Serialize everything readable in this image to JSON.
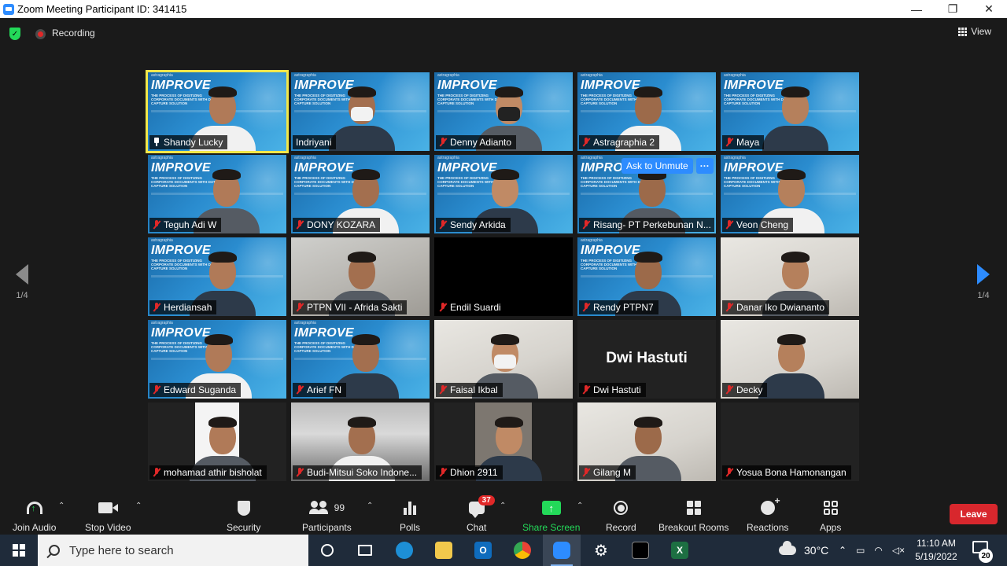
{
  "window": {
    "title": "Zoom Meeting Participant ID: 341415",
    "minimize": "—",
    "restore": "❐",
    "close": "✕"
  },
  "topbar": {
    "recording_label": "Recording",
    "view_label": "View"
  },
  "pager": {
    "left_text": "1/4",
    "right_text": "1/4"
  },
  "ask_to_unmute": {
    "label": "Ask to Unmute",
    "more": "···"
  },
  "tiles": [
    {
      "name": "Shandy Lucky",
      "bg": "improve",
      "state": "pinned",
      "active": true
    },
    {
      "name": "Indriyani",
      "bg": "improve",
      "state": "none"
    },
    {
      "name": "Denny Adianto",
      "bg": "improve",
      "state": "muted"
    },
    {
      "name": "Astragraphia 2",
      "bg": "improve",
      "state": "muted"
    },
    {
      "name": "Maya",
      "bg": "improve",
      "state": "muted"
    },
    {
      "name": "Teguh Adi W",
      "bg": "improve",
      "state": "muted"
    },
    {
      "name": "DONY KOZARA",
      "bg": "improve",
      "state": "muted"
    },
    {
      "name": "Sendy Arkida",
      "bg": "improve",
      "state": "muted"
    },
    {
      "name": "Risang- PT Perkebunan N...",
      "bg": "improve",
      "state": "muted"
    },
    {
      "name": "Veon Cheng",
      "bg": "improve",
      "state": "muted"
    },
    {
      "name": "Herdiansah",
      "bg": "improve",
      "state": "muted"
    },
    {
      "name": "PTPN VII - Afrida Sakti",
      "bg": "room",
      "state": "muted"
    },
    {
      "name": "Endil Suardi",
      "bg": "black",
      "state": "muted"
    },
    {
      "name": "Rendy PTPN7",
      "bg": "improve",
      "state": "muted"
    },
    {
      "name": "Danar Iko Dwiananto",
      "bg": "white-room",
      "state": "muted"
    },
    {
      "name": "Edward Suganda",
      "bg": "improve",
      "state": "muted"
    },
    {
      "name": "Arief FN",
      "bg": "improve",
      "state": "muted"
    },
    {
      "name": "Faisal Ikbal",
      "bg": "white-room",
      "state": "muted"
    },
    {
      "name": "Dwi Hastuti",
      "bg": "dark",
      "state": "muted",
      "card": "Dwi Hastuti"
    },
    {
      "name": "Decky",
      "bg": "white-room",
      "state": "muted"
    },
    {
      "name": "mohamad athir bisholat",
      "bg": "dark",
      "state": "muted",
      "portrait": true
    },
    {
      "name": "Budi-Mitsui Soko Indone...",
      "bg": "ceiling",
      "state": "muted"
    },
    {
      "name": "Dhion 2911",
      "bg": "dark",
      "state": "muted",
      "portrait": true
    },
    {
      "name": "Gilang M",
      "bg": "white-room",
      "state": "muted"
    },
    {
      "name": "Yosua Bona Hamonangan",
      "bg": "dark",
      "state": "muted"
    }
  ],
  "improve_bg": {
    "brand": "astragraphia",
    "headline": "IMPROVE",
    "subline": "THE PROCESS OF DIGITIZING CORPORATE DOCUMENTS WITH DATA CAPTURE SOLUTION"
  },
  "toolbar": {
    "join_audio": "Join Audio",
    "stop_video": "Stop Video",
    "security": "Security",
    "participants": "Participants",
    "participants_count": "99",
    "polls": "Polls",
    "chat": "Chat",
    "chat_badge": "37",
    "share_screen": "Share Screen",
    "record": "Record",
    "breakout_rooms": "Breakout Rooms",
    "reactions": "Reactions",
    "apps": "Apps",
    "leave": "Leave"
  },
  "taskbar": {
    "search_placeholder": "Type here to search",
    "temperature": "30°C",
    "time": "11:10 AM",
    "date": "5/19/2022",
    "notification_count": "20"
  },
  "colors": {
    "zoom_blue": "#2d8cff",
    "share_green": "#23d959",
    "leave_red": "#d8272d",
    "active_speaker": "#f2e74a",
    "mute_red": "#e02828"
  }
}
